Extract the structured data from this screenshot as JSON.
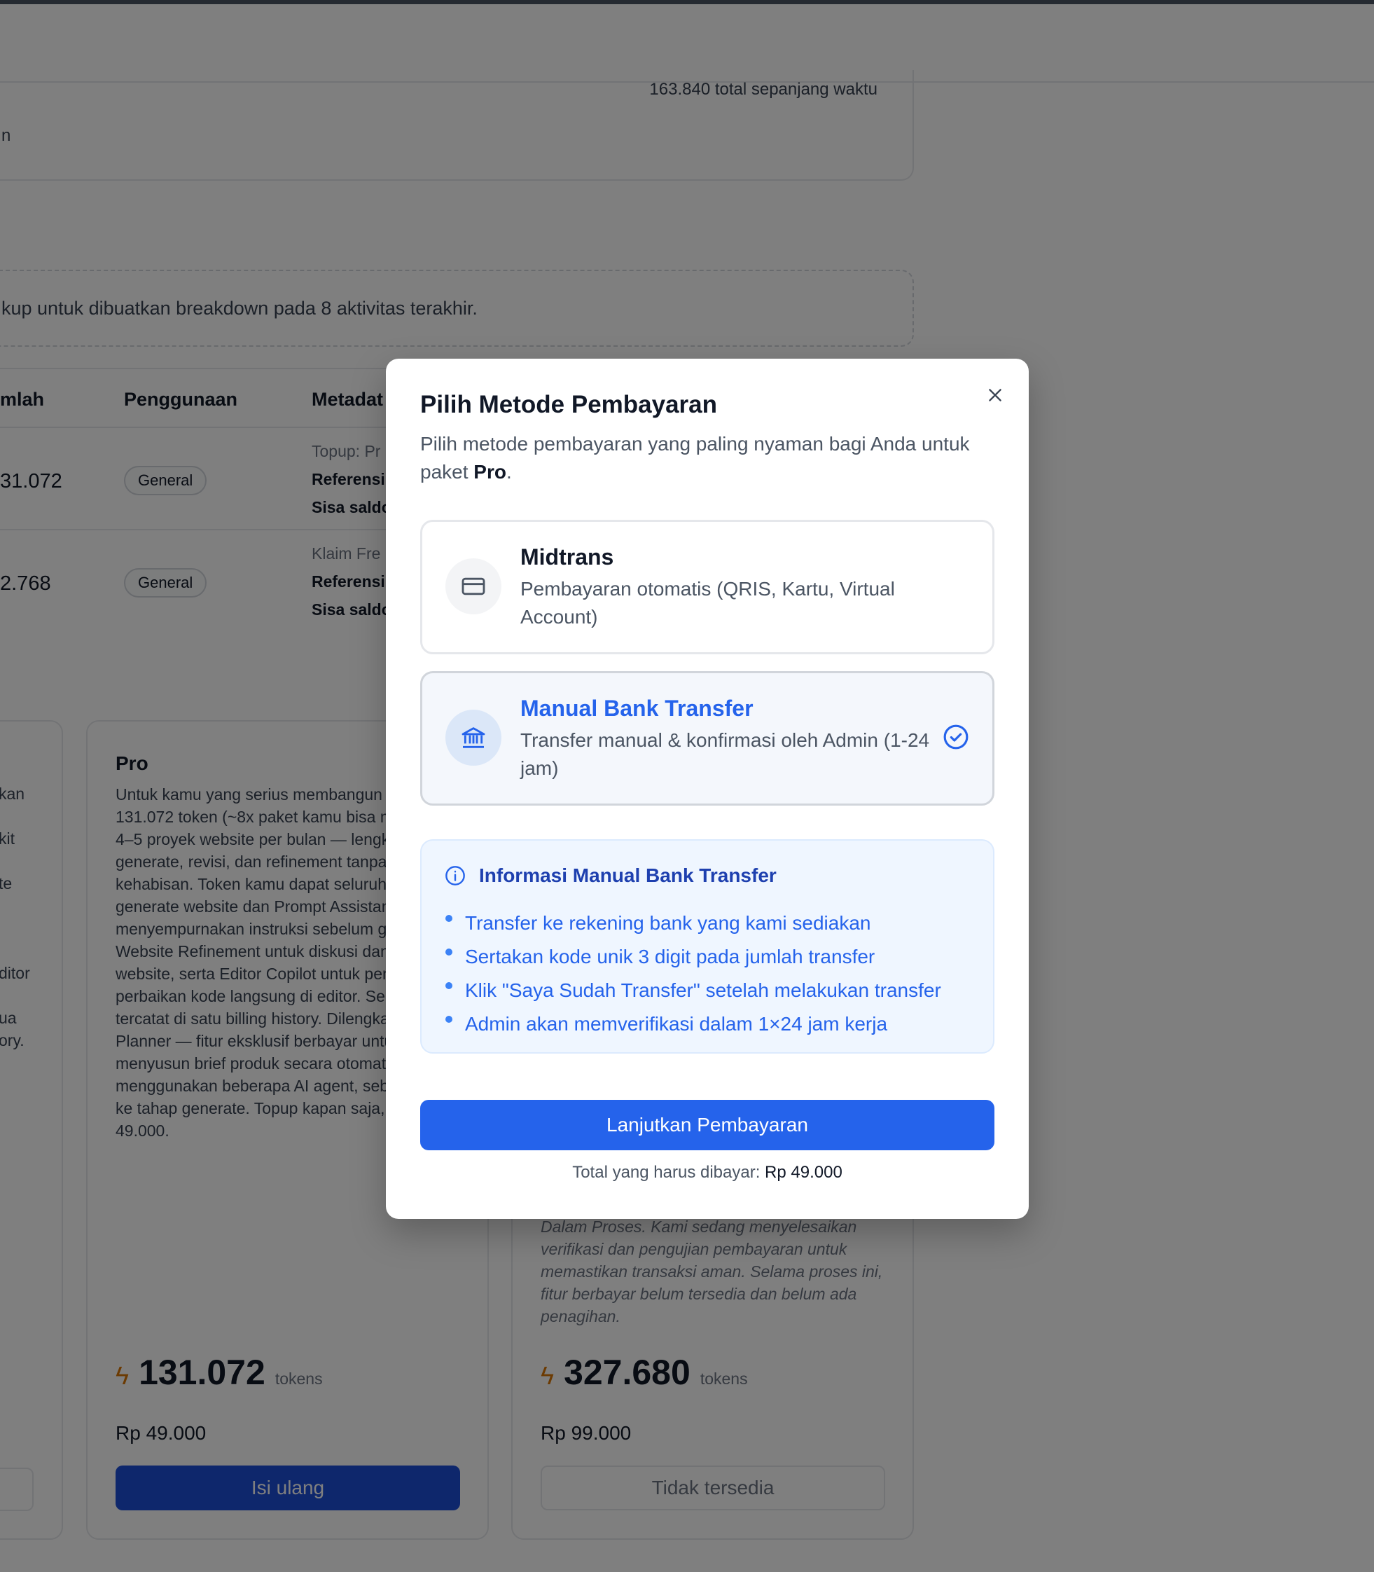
{
  "background": {
    "stat_total": "163.840 total sepanjang waktu",
    "stat_fragment": "n",
    "info_text": "kup untuk dibuatkan breakdown pada 8 aktivitas terakhir.",
    "table": {
      "headers": [
        "mlah",
        "Penggunaan",
        "Metadat"
      ],
      "rows": [
        {
          "amount": "31.072",
          "badge": "General",
          "meta1": "Topup: Pr",
          "meta2": "Referensi",
          "meta3": "Sisa saldo"
        },
        {
          "amount": "2.768",
          "badge": "General",
          "meta1": "Klaim Fre",
          "meta2": "Referensi",
          "meta3": "Sisa saldo"
        }
      ]
    },
    "plan_left_fragments": [
      "kan",
      "kit",
      "te",
      "ditor",
      "ua",
      "ory."
    ],
    "plans": {
      "pro": {
        "name": "Pro",
        "description": "Untuk kamu yang serius membangun Dengan 131.072 token (~8x paket kamu bisa mengerjakan 4–5 proyek website per bulan — lengkap dengan generate, revisi, dan refinement tanpa khawatir kehabisan. Token kamu dapat seluruh fitur: generate website dan Prompt Assistant untuk menyempurnakan instruksi sebelum generate, Website Refinement untuk diskusi dan revisi website, serta Editor Copilot untuk penjelasan atau perbaikan kode langsung di editor. Semua aktivitas tercatat di satu billing history. Dilengkapi Multi Planner — fitur eksklusif berbayar untuk menyusun brief produk secara otomatis menggunakan beberapa AI agent, sebelum masuk ke tahap generate. Topup kapan saja, hanya Rp 49.000.",
        "tokens": "131.072",
        "tokens_unit": "tokens",
        "price": "Rp 49.000",
        "action": "Isi ulang"
      },
      "max": {
        "note": "Dalam Proses. Kami sedang menyelesaikan verifikasi dan pengujian pembayaran untuk memastikan transaksi aman. Selama proses ini, fitur berbayar belum tersedia dan belum ada penagihan.",
        "tokens": "327.680",
        "tokens_unit": "tokens",
        "price": "Rp 99.000",
        "action": "Tidak tersedia"
      }
    }
  },
  "modal": {
    "title": "Pilih Metode Pembayaran",
    "subtitle_prefix": "Pilih metode pembayaran yang paling nyaman bagi Anda untuk paket ",
    "subtitle_plan": "Pro",
    "subtitle_suffix": ".",
    "options": [
      {
        "name": "Midtrans",
        "description": "Pembayaran otomatis (QRIS, Kartu, Virtual Account)",
        "icon": "credit-card-icon",
        "selected": false
      },
      {
        "name": "Manual Bank Transfer",
        "description": "Transfer manual & konfirmasi oleh Admin (1-24 jam)",
        "icon": "bank-icon",
        "selected": true
      }
    ],
    "info": {
      "title": "Informasi Manual Bank Transfer",
      "items": [
        "Transfer ke rekening bank yang kami sediakan",
        "Sertakan kode unik 3 digit pada jumlah transfer",
        "Klik \"Saya Sudah Transfer\" setelah melakukan transfer",
        "Admin akan memverifikasi dalam 1×24 jam kerja"
      ]
    },
    "cta": "Lanjutkan Pembayaran",
    "total_label": "Total yang harus dibayar: ",
    "total_value": "Rp 49.000"
  },
  "colors": {
    "accent": "#2563eb",
    "overlay": "rgba(0,0,0,0.5)",
    "pro_button": "#1d4ed8",
    "bolt": "#d97706"
  }
}
